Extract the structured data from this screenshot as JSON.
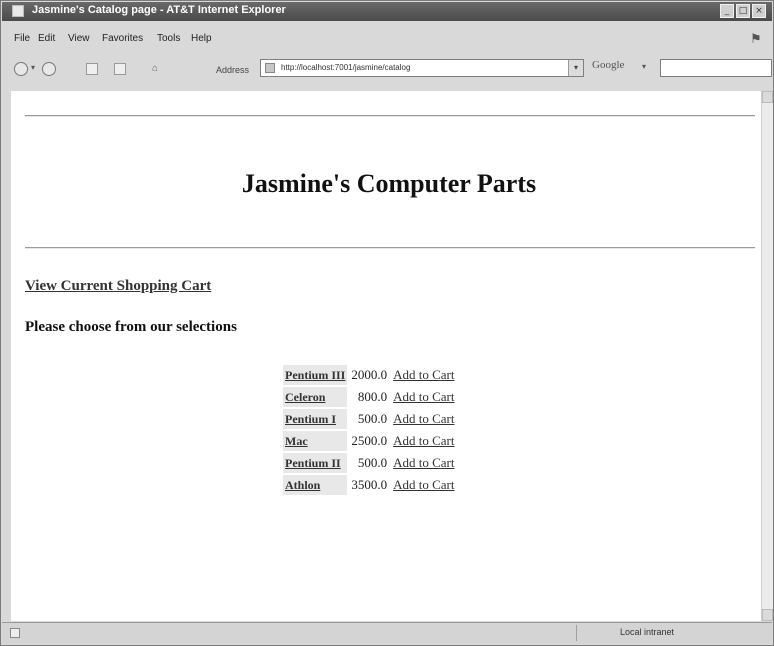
{
  "window": {
    "title": "Jasmine's Catalog page - AT&T Internet Explorer"
  },
  "menu": [
    "File",
    "Edit",
    "View",
    "Favorites",
    "Tools",
    "Help"
  ],
  "address": {
    "label": "Address",
    "url": "http://localhost:7001/jasmine/catalog"
  },
  "search": {
    "brand": "Google"
  },
  "page": {
    "title": "Jasmine's Computer Parts",
    "cart_link": "View Current Shopping Cart",
    "selections_heading": "Please choose from our selections",
    "add_label": "Add to Cart",
    "products": [
      {
        "name": "Pentium III",
        "price": "2000.0"
      },
      {
        "name": "Celeron",
        "price": "800.0"
      },
      {
        "name": "Pentium I",
        "price": "500.0"
      },
      {
        "name": "Mac",
        "price": "2500.0"
      },
      {
        "name": "Pentium II",
        "price": "500.0"
      },
      {
        "name": "Athlon",
        "price": "3500.0"
      }
    ]
  },
  "status": {
    "zone": "Local intranet"
  }
}
